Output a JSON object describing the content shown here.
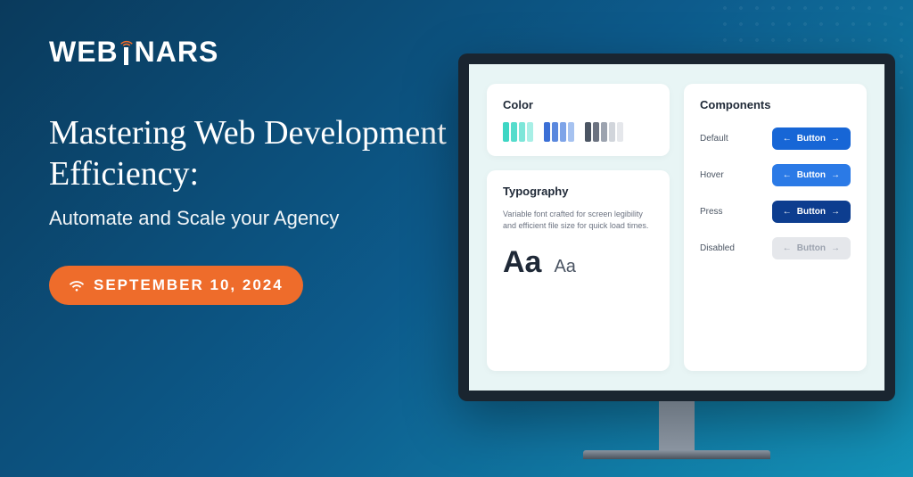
{
  "logo": {
    "pre": "WEB",
    "post": "NARS"
  },
  "title": "Mastering Web Development Efficiency:",
  "subtitle": "Automate and Scale your Agency",
  "date": "SEPTEMBER 10, 2024",
  "screen": {
    "color": {
      "title": "Color"
    },
    "typography": {
      "title": "Typography",
      "desc": "Variable font crafted for screen legibility and efficient file size for quick load times.",
      "big": "Aa",
      "small": "Aa"
    },
    "components": {
      "title": "Components",
      "rows": [
        {
          "label": "Default",
          "btn": "Button"
        },
        {
          "label": "Hover",
          "btn": "Button"
        },
        {
          "label": "Press",
          "btn": "Button"
        },
        {
          "label": "Disabled",
          "btn": "Button"
        }
      ]
    }
  },
  "colors": {
    "group1": [
      "#3dd6c4",
      "#55dccc",
      "#7de6d9",
      "#a8efe6"
    ],
    "group2": [
      "#3b6fd6",
      "#5a88de",
      "#7ea4e8",
      "#a6c2f0"
    ],
    "group3": [
      "#4b5563",
      "#6b7280",
      "#9ca3af",
      "#d1d5db",
      "#e5e7eb"
    ]
  }
}
